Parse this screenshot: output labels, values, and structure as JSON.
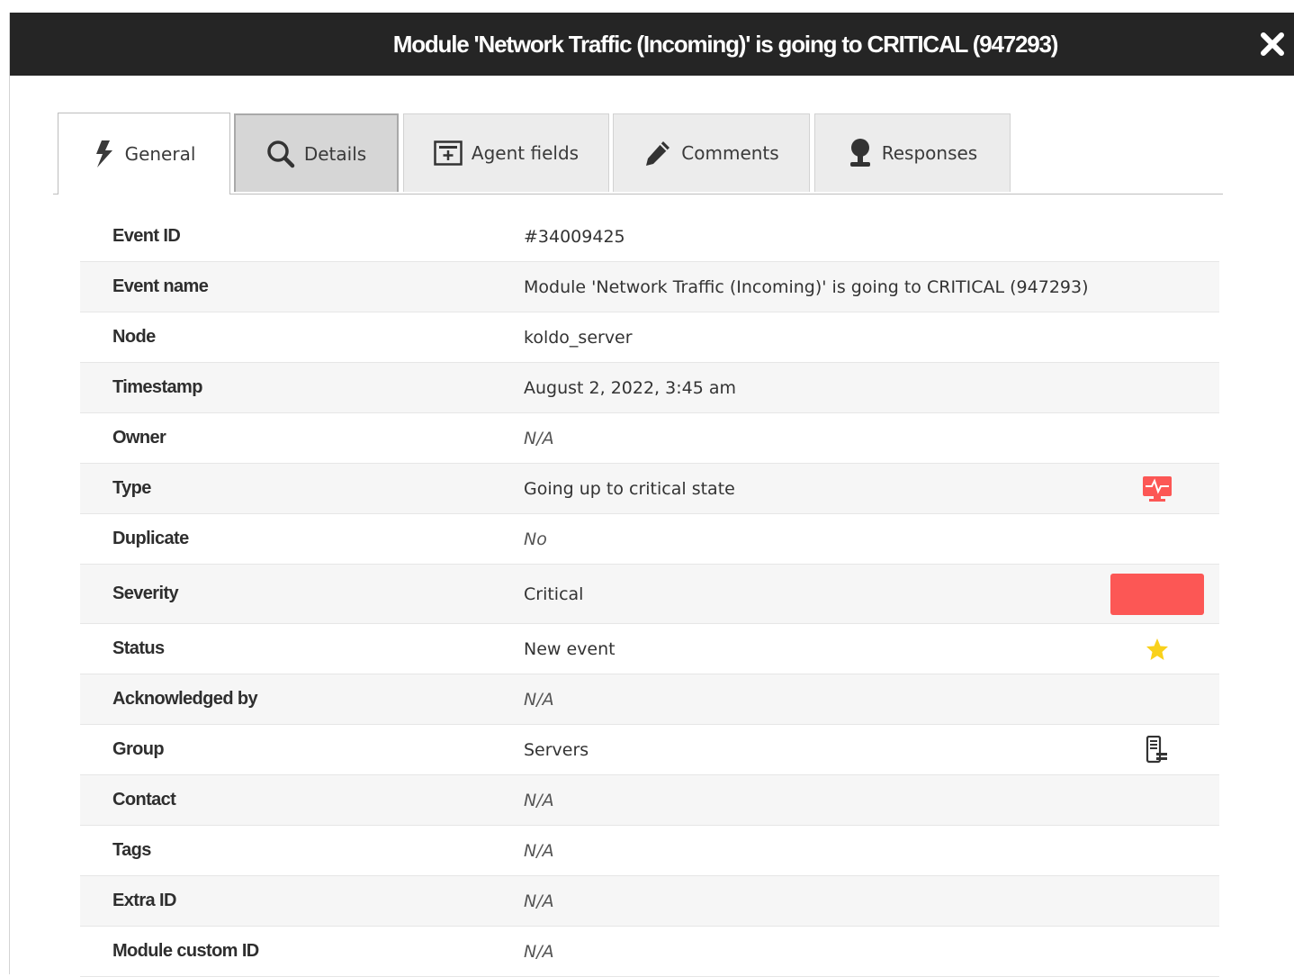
{
  "dialog": {
    "title": "Module 'Network Traffic (Incoming)' is going to CRITICAL (947293)"
  },
  "tabs": [
    {
      "label": "General",
      "icon": "lightning-icon"
    },
    {
      "label": "Details",
      "icon": "search-icon"
    },
    {
      "label": "Agent fields",
      "icon": "agent-fields-icon"
    },
    {
      "label": "Comments",
      "icon": "pencil-icon"
    },
    {
      "label": "Responses",
      "icon": "pushpin-icon"
    }
  ],
  "fields": {
    "event_id": {
      "label": "Event ID",
      "value": "#34009425"
    },
    "event_name": {
      "label": "Event name",
      "value": "Module 'Network Traffic (Incoming)' is going to CRITICAL (947293)"
    },
    "node": {
      "label": "Node",
      "value": "koldo_server"
    },
    "timestamp": {
      "label": "Timestamp",
      "value": "August 2, 2022, 3:45 am"
    },
    "owner": {
      "label": "Owner",
      "value": "N/A"
    },
    "type": {
      "label": "Type",
      "value": "Going up to critical state",
      "icon": "critical-monitor-icon"
    },
    "duplicate": {
      "label": "Duplicate",
      "value": "No"
    },
    "severity": {
      "label": "Severity",
      "value": "Critical"
    },
    "status": {
      "label": "Status",
      "value": "New event",
      "icon": "star-icon"
    },
    "acknowledged_by": {
      "label": "Acknowledged by",
      "value": "N/A"
    },
    "group": {
      "label": "Group",
      "value": "Servers",
      "icon": "server-icon"
    },
    "contact": {
      "label": "Contact",
      "value": "N/A"
    },
    "tags": {
      "label": "Tags",
      "value": "N/A"
    },
    "extra_id": {
      "label": "Extra ID",
      "value": "N/A"
    },
    "module_custom_id": {
      "label": "Module custom ID",
      "value": "N/A"
    }
  },
  "colors": {
    "titlebar": "#252525",
    "critical": "#fc5755",
    "star": "#f9d11b"
  }
}
